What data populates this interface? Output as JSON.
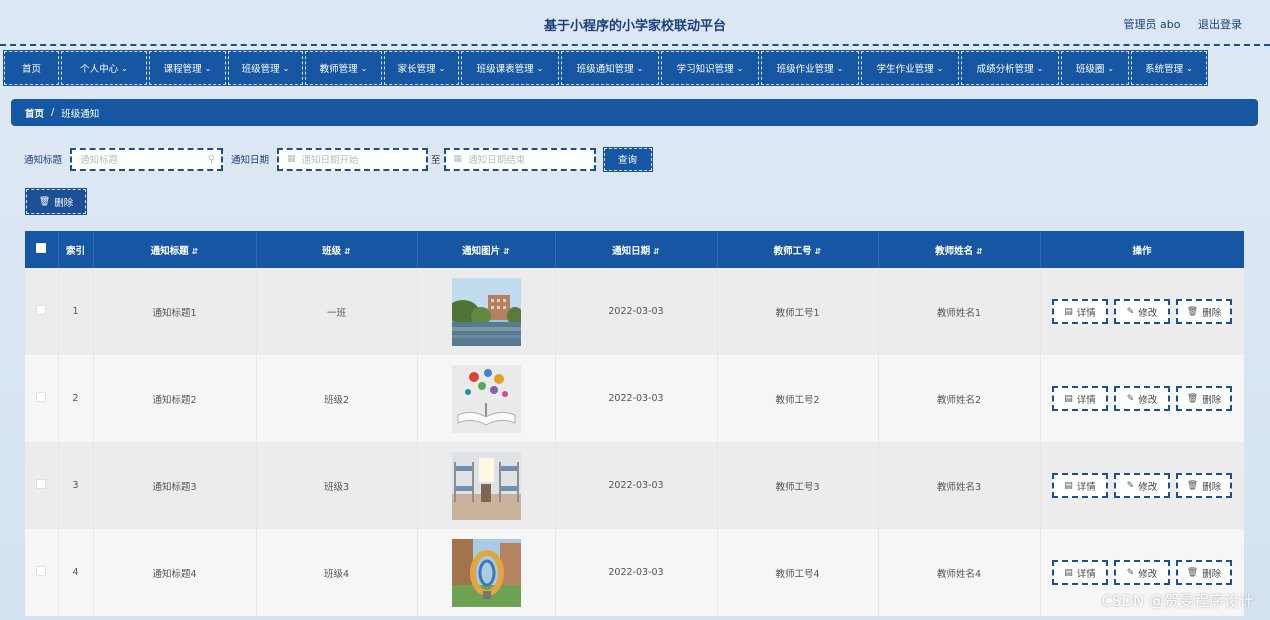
{
  "header": {
    "title": "基于小程序的小学家校联动平台",
    "user": "管理员 abo",
    "logout": "退出登录"
  },
  "nav": [
    {
      "label": "首页",
      "dropdown": false
    },
    {
      "label": "个人中心",
      "dropdown": true
    },
    {
      "label": "课程管理",
      "dropdown": true
    },
    {
      "label": "班级管理",
      "dropdown": true
    },
    {
      "label": "教师管理",
      "dropdown": true
    },
    {
      "label": "家长管理",
      "dropdown": true
    },
    {
      "label": "班级课表管理",
      "dropdown": true
    },
    {
      "label": "班级通知管理",
      "dropdown": true
    },
    {
      "label": "学习知识管理",
      "dropdown": true
    },
    {
      "label": "班级作业管理",
      "dropdown": true
    },
    {
      "label": "学生作业管理",
      "dropdown": true
    },
    {
      "label": "成绩分析管理",
      "dropdown": true
    },
    {
      "label": "班级圈",
      "dropdown": true
    },
    {
      "label": "系统管理",
      "dropdown": true
    }
  ],
  "breadcrumb": {
    "home": "首页",
    "separator": "/",
    "current": "班级通知"
  },
  "search": {
    "title_label": "通知标题",
    "title_placeholder": "通知标题",
    "date_label": "通知日期",
    "date_start_placeholder": "通知日期开始",
    "date_to": "至",
    "date_end_placeholder": "通知日期结束",
    "query_button": "查询"
  },
  "toolbar": {
    "delete_button": "删除"
  },
  "table": {
    "columns": [
      "索引",
      "通知标题",
      "班级",
      "通知图片",
      "通知日期",
      "教师工号",
      "教师姓名",
      "操作"
    ],
    "rows": [
      {
        "index": "1",
        "title": "通知标题1",
        "class": "一班",
        "image": "campus-building-photo",
        "date": "2022-03-03",
        "teacher_no": "教师工号1",
        "teacher_name": "教师姓名1"
      },
      {
        "index": "2",
        "title": "通知标题2",
        "class": "班级2",
        "image": "open-book-illustration",
        "date": "2022-03-03",
        "teacher_no": "教师工号2",
        "teacher_name": "教师姓名2"
      },
      {
        "index": "3",
        "title": "通知标题3",
        "class": "班级3",
        "image": "dormitory-room-photo",
        "date": "2022-03-03",
        "teacher_no": "教师工号3",
        "teacher_name": "教师姓名3"
      },
      {
        "index": "4",
        "title": "通知标题4",
        "class": "班级4",
        "image": "sculpture-campus-photo",
        "date": "2022-03-03",
        "teacher_no": "教师工号4",
        "teacher_name": "教师姓名4"
      }
    ],
    "actions": {
      "detail": "详情",
      "edit": "修改",
      "delete": "删除"
    }
  },
  "watermark": "CSDN @贺旻程序设计",
  "colors": {
    "primary": "#1656a2",
    "header_bg": "#dbe7f4",
    "page_bg": "#d4e2f1"
  }
}
